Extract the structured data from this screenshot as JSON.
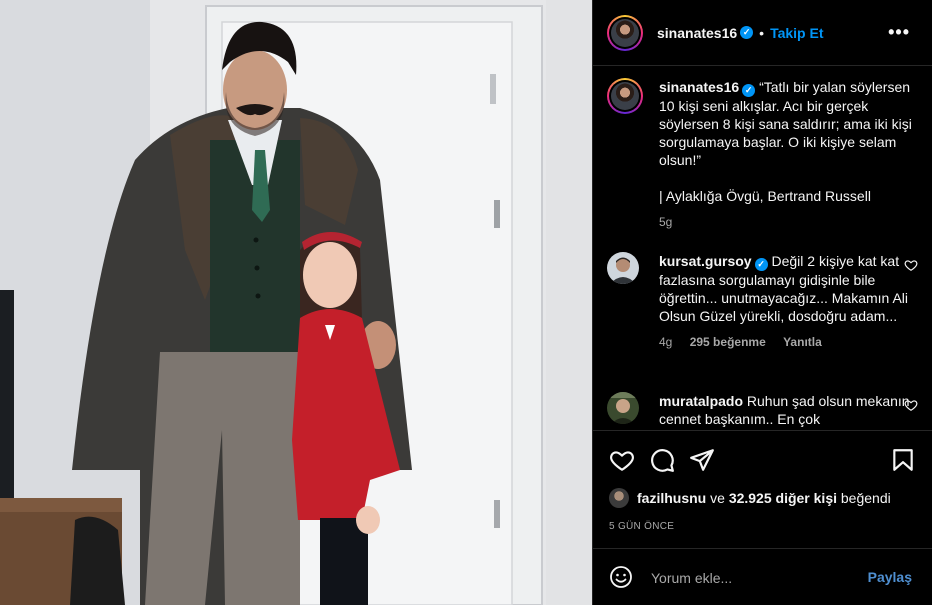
{
  "post": {
    "username": "sinanates16",
    "verified_mark": "✓",
    "dot": "•",
    "follow_label": "Takip Et",
    "more_label": "•••"
  },
  "caption": {
    "username": "sinanates16",
    "text": "“Tatlı bir yalan söylersen 10 kişi seni alkışlar. Acı bir gerçek söylersen 8 kişi sana saldırır; ama iki kişi sorgulamaya başlar. O iki kişiye selam olsun!”",
    "source": "| Aylaklığa Övgü, Bertrand Russell",
    "age": "5g"
  },
  "comments": [
    {
      "username": "kursat.gursoy",
      "verified": true,
      "text": "Değil 2 kişiye kat kat fazlasına sorgulamayı gidişinle bile öğrettin... unutmayacağız... Makamın Ali Olsun Güzel yürekli, dosdoğru adam...",
      "age": "4g",
      "likes": "295 beğenme",
      "reply": "Yanıtla"
    },
    {
      "username": "muratalpado",
      "verified": false,
      "text": "Ruhun şad olsun mekanın cennet başkanım.. En çok"
    }
  ],
  "likes": {
    "user": "fazilhusnu",
    "connector": "ve",
    "others": "32.925 diğer kişi",
    "suffix": "beğendi"
  },
  "date_label": "5 GÜN ÖNCE",
  "comment_box": {
    "placeholder": "Yorum ekle...",
    "post_label": "Paylaş"
  },
  "icons": {
    "header": "avatar",
    "actions": [
      "heart-icon",
      "comment-icon",
      "share-icon",
      "bookmark-icon"
    ],
    "comment_box": "emoji-icon"
  },
  "colors": {
    "background": "#000000",
    "text": "#f5f5f5",
    "muted": "#a8a8a8",
    "link": "#0095f6",
    "verified": "#0095f6"
  }
}
